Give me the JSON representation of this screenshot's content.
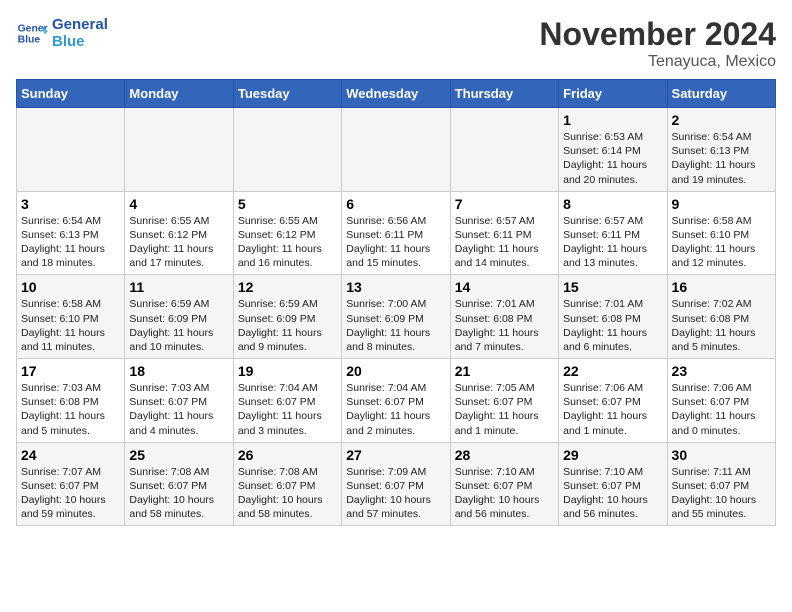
{
  "header": {
    "logo_line1": "General",
    "logo_line2": "Blue",
    "month": "November 2024",
    "location": "Tenayuca, Mexico"
  },
  "weekdays": [
    "Sunday",
    "Monday",
    "Tuesday",
    "Wednesday",
    "Thursday",
    "Friday",
    "Saturday"
  ],
  "weeks": [
    [
      {
        "day": "",
        "info": ""
      },
      {
        "day": "",
        "info": ""
      },
      {
        "day": "",
        "info": ""
      },
      {
        "day": "",
        "info": ""
      },
      {
        "day": "",
        "info": ""
      },
      {
        "day": "1",
        "info": "Sunrise: 6:53 AM\nSunset: 6:14 PM\nDaylight: 11 hours and 20 minutes."
      },
      {
        "day": "2",
        "info": "Sunrise: 6:54 AM\nSunset: 6:13 PM\nDaylight: 11 hours and 19 minutes."
      }
    ],
    [
      {
        "day": "3",
        "info": "Sunrise: 6:54 AM\nSunset: 6:13 PM\nDaylight: 11 hours and 18 minutes."
      },
      {
        "day": "4",
        "info": "Sunrise: 6:55 AM\nSunset: 6:12 PM\nDaylight: 11 hours and 17 minutes."
      },
      {
        "day": "5",
        "info": "Sunrise: 6:55 AM\nSunset: 6:12 PM\nDaylight: 11 hours and 16 minutes."
      },
      {
        "day": "6",
        "info": "Sunrise: 6:56 AM\nSunset: 6:11 PM\nDaylight: 11 hours and 15 minutes."
      },
      {
        "day": "7",
        "info": "Sunrise: 6:57 AM\nSunset: 6:11 PM\nDaylight: 11 hours and 14 minutes."
      },
      {
        "day": "8",
        "info": "Sunrise: 6:57 AM\nSunset: 6:11 PM\nDaylight: 11 hours and 13 minutes."
      },
      {
        "day": "9",
        "info": "Sunrise: 6:58 AM\nSunset: 6:10 PM\nDaylight: 11 hours and 12 minutes."
      }
    ],
    [
      {
        "day": "10",
        "info": "Sunrise: 6:58 AM\nSunset: 6:10 PM\nDaylight: 11 hours and 11 minutes."
      },
      {
        "day": "11",
        "info": "Sunrise: 6:59 AM\nSunset: 6:09 PM\nDaylight: 11 hours and 10 minutes."
      },
      {
        "day": "12",
        "info": "Sunrise: 6:59 AM\nSunset: 6:09 PM\nDaylight: 11 hours and 9 minutes."
      },
      {
        "day": "13",
        "info": "Sunrise: 7:00 AM\nSunset: 6:09 PM\nDaylight: 11 hours and 8 minutes."
      },
      {
        "day": "14",
        "info": "Sunrise: 7:01 AM\nSunset: 6:08 PM\nDaylight: 11 hours and 7 minutes."
      },
      {
        "day": "15",
        "info": "Sunrise: 7:01 AM\nSunset: 6:08 PM\nDaylight: 11 hours and 6 minutes."
      },
      {
        "day": "16",
        "info": "Sunrise: 7:02 AM\nSunset: 6:08 PM\nDaylight: 11 hours and 5 minutes."
      }
    ],
    [
      {
        "day": "17",
        "info": "Sunrise: 7:03 AM\nSunset: 6:08 PM\nDaylight: 11 hours and 5 minutes."
      },
      {
        "day": "18",
        "info": "Sunrise: 7:03 AM\nSunset: 6:07 PM\nDaylight: 11 hours and 4 minutes."
      },
      {
        "day": "19",
        "info": "Sunrise: 7:04 AM\nSunset: 6:07 PM\nDaylight: 11 hours and 3 minutes."
      },
      {
        "day": "20",
        "info": "Sunrise: 7:04 AM\nSunset: 6:07 PM\nDaylight: 11 hours and 2 minutes."
      },
      {
        "day": "21",
        "info": "Sunrise: 7:05 AM\nSunset: 6:07 PM\nDaylight: 11 hours and 1 minute."
      },
      {
        "day": "22",
        "info": "Sunrise: 7:06 AM\nSunset: 6:07 PM\nDaylight: 11 hours and 1 minute."
      },
      {
        "day": "23",
        "info": "Sunrise: 7:06 AM\nSunset: 6:07 PM\nDaylight: 11 hours and 0 minutes."
      }
    ],
    [
      {
        "day": "24",
        "info": "Sunrise: 7:07 AM\nSunset: 6:07 PM\nDaylight: 10 hours and 59 minutes."
      },
      {
        "day": "25",
        "info": "Sunrise: 7:08 AM\nSunset: 6:07 PM\nDaylight: 10 hours and 58 minutes."
      },
      {
        "day": "26",
        "info": "Sunrise: 7:08 AM\nSunset: 6:07 PM\nDaylight: 10 hours and 58 minutes."
      },
      {
        "day": "27",
        "info": "Sunrise: 7:09 AM\nSunset: 6:07 PM\nDaylight: 10 hours and 57 minutes."
      },
      {
        "day": "28",
        "info": "Sunrise: 7:10 AM\nSunset: 6:07 PM\nDaylight: 10 hours and 56 minutes."
      },
      {
        "day": "29",
        "info": "Sunrise: 7:10 AM\nSunset: 6:07 PM\nDaylight: 10 hours and 56 minutes."
      },
      {
        "day": "30",
        "info": "Sunrise: 7:11 AM\nSunset: 6:07 PM\nDaylight: 10 hours and 55 minutes."
      }
    ]
  ]
}
